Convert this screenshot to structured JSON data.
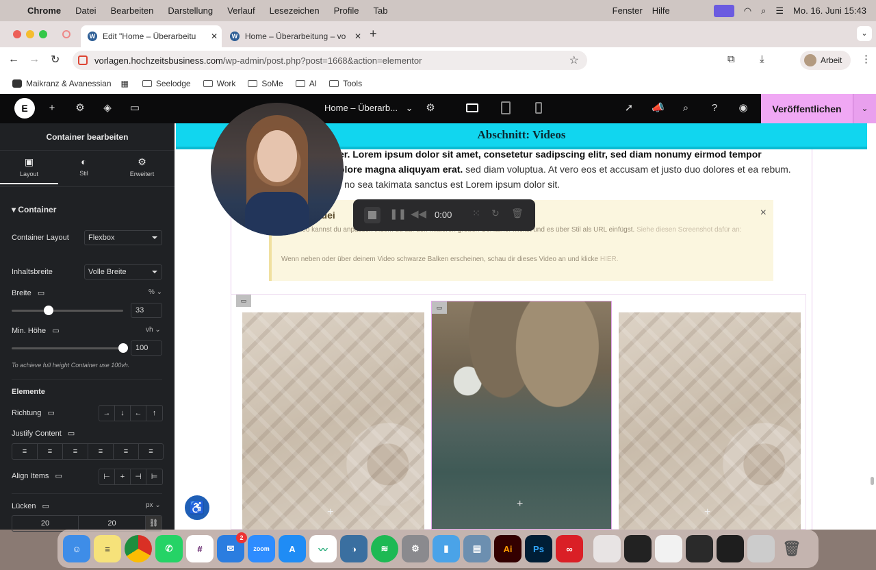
{
  "menubar": {
    "app": "Chrome",
    "items": [
      "Datei",
      "Bearbeiten",
      "Darstellung",
      "Verlauf",
      "Lesezeichen",
      "Profile",
      "Tab"
    ],
    "right_items": [
      "Fenster",
      "Hilfe"
    ],
    "datetime": "Mo. 16. Juni  15:43"
  },
  "browser": {
    "tabs": [
      {
        "title": "Edit \"Home – Überarbeitu",
        "active": true
      },
      {
        "title": "Home – Überarbeitung – vorl",
        "active": false
      }
    ],
    "url_host": "vorlagen.hochzeitsbusiness.com",
    "url_path": "/wp-admin/post.php?post=1668&action=elementor",
    "profile": "Arbeit",
    "bookmarks": [
      "Maikranz & Avanessian",
      "Seelodge",
      "Work",
      "SoMe",
      "AI",
      "Tools"
    ]
  },
  "editor": {
    "page_title": "Home – Überarb...",
    "publish_label": "Veröffentlichen"
  },
  "panel": {
    "title": "Container bearbeiten",
    "tabs": [
      "Layout",
      "Stil",
      "Erweitert"
    ],
    "section": "Container",
    "container_layout_label": "Container Layout",
    "container_layout_value": "Flexbox",
    "content_width_label": "Inhaltsbreite",
    "content_width_value": "Volle Breite",
    "width_label": "Breite",
    "width_unit": "%",
    "width_value": "33",
    "width_fraction": 0.33,
    "minheight_label": "Min. Höhe",
    "minheight_unit": "vh",
    "minheight_value": "100",
    "minheight_fraction": 1.0,
    "hint": "To achieve full height Container use 100vh.",
    "elements_title": "Elemente",
    "direction_label": "Richtung",
    "direction_buttons": [
      "→",
      "↓",
      "←",
      "↑"
    ],
    "justify_label": "Justify Content",
    "align_label": "Align Items",
    "gap_label": "Lücken",
    "gap_unit": "px",
    "gap_values": [
      "20",
      "20"
    ]
  },
  "canvas": {
    "section_heading": "Abschnitt: Videos",
    "text_bold_line1": "er. Lorem ipsum dolor sit amet, consetetur sadipscing elitr, sed diam nonumy eirmod tempor",
    "text_bold_line2": "olore magna aliquyam erat.",
    "text_line2_rest": " sed diam voluptua. At vero eos et accusam et justo duo dolores et ea rebum.",
    "text_line3": "no sea takimata sanctus est Lorem ipsum dolor sit.",
    "note_title": "für dei",
    "note_line1": "Video kannst du anpassen indem du auf den mittleren großen Container klickst und es über Stil als URL einfügst.",
    "note_line1_link": "Siehe diesen Screenshot dafür an:",
    "note_line2": "Wenn neben oder über deinem Video schwarze Balken erscheinen, schau dir dieses Video an und klicke",
    "note_line2_link": "HIER.",
    "note_close": "×",
    "recorder_time": "0:00"
  },
  "dock": {
    "zoom_label": "zoom",
    "mail_badge": "2"
  }
}
